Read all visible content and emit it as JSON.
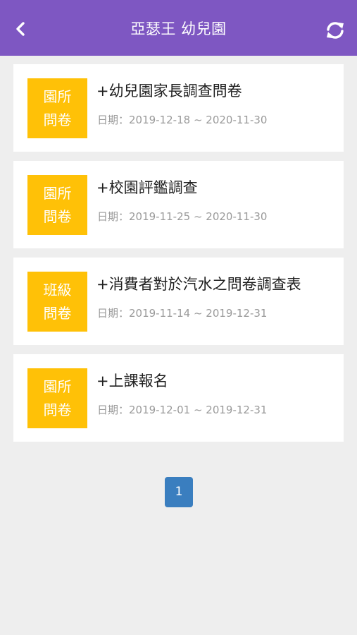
{
  "header": {
    "title": "亞瑟王 幼兒園",
    "back_icon": "chevron-left-icon",
    "refresh_icon": "refresh-icon",
    "background_color": "#7e57c2"
  },
  "surveys": [
    {
      "badge_line1": "園所",
      "badge_line2": "問卷",
      "title": "+幼兒園家長調查問卷",
      "date": "日期：2019-12-18 ~ 2020-11-30"
    },
    {
      "badge_line1": "園所",
      "badge_line2": "問卷",
      "title": "+校園評鑑調查",
      "date": "日期：2019-11-25 ~ 2020-11-30"
    },
    {
      "badge_line1": "班級",
      "badge_line2": "問卷",
      "title": "+消費者對於汽水之問卷調查表",
      "date": "日期：2019-11-14 ~ 2019-12-31"
    },
    {
      "badge_line1": "園所",
      "badge_line2": "問卷",
      "title": "+上課報名",
      "date": "日期：2019-12-01 ~ 2019-12-31"
    }
  ],
  "badge_color": "#ffc107",
  "pagination": {
    "current_page": "1",
    "color": "#3a7ebf"
  }
}
